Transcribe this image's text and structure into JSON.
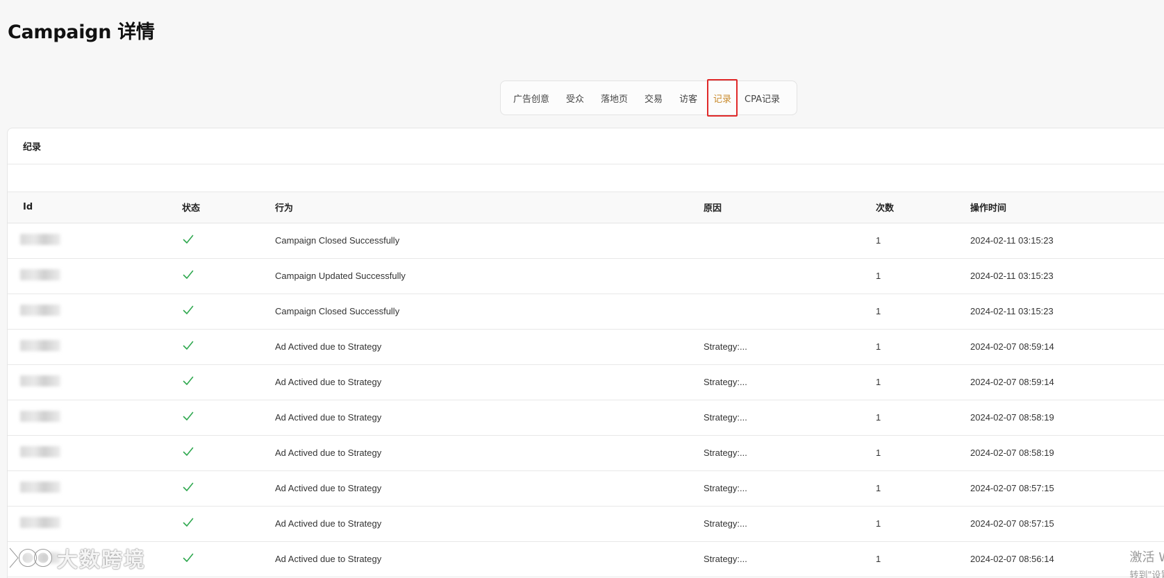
{
  "page": {
    "title": "Campaign 详情"
  },
  "tabs": [
    {
      "label": "广告创意",
      "active": false
    },
    {
      "label": "受众",
      "active": false
    },
    {
      "label": "落地页",
      "active": false
    },
    {
      "label": "交易",
      "active": false
    },
    {
      "label": "访客",
      "active": false
    },
    {
      "label": "记录",
      "active": true
    },
    {
      "label": "CPA记录",
      "active": false
    }
  ],
  "card": {
    "title": "纪录",
    "columns": [
      "Id",
      "状态",
      "行为",
      "原因",
      "次数",
      "操作时间"
    ],
    "rows": [
      {
        "status": "success",
        "action": "Campaign Closed Successfully",
        "reason": "",
        "count": "1",
        "time": "2024-02-11 03:15:23"
      },
      {
        "status": "success",
        "action": "Campaign Updated Successfully",
        "reason": "",
        "count": "1",
        "time": "2024-02-11 03:15:23"
      },
      {
        "status": "success",
        "action": "Campaign Closed Successfully",
        "reason": "",
        "count": "1",
        "time": "2024-02-11 03:15:23"
      },
      {
        "status": "success",
        "action": "Ad Actived due to Strategy",
        "reason": "Strategy:...",
        "count": "1",
        "time": "2024-02-07 08:59:14"
      },
      {
        "status": "success",
        "action": "Ad Actived due to Strategy",
        "reason": "Strategy:...",
        "count": "1",
        "time": "2024-02-07 08:59:14"
      },
      {
        "status": "success",
        "action": "Ad Actived due to Strategy",
        "reason": "Strategy:...",
        "count": "1",
        "time": "2024-02-07 08:58:19"
      },
      {
        "status": "success",
        "action": "Ad Actived due to Strategy",
        "reason": "Strategy:...",
        "count": "1",
        "time": "2024-02-07 08:58:19"
      },
      {
        "status": "success",
        "action": "Ad Actived due to Strategy",
        "reason": "Strategy:...",
        "count": "1",
        "time": "2024-02-07 08:57:15"
      },
      {
        "status": "success",
        "action": "Ad Actived due to Strategy",
        "reason": "Strategy:...",
        "count": "1",
        "time": "2024-02-07 08:57:15"
      },
      {
        "status": "success",
        "action": "Ad Actived due to Strategy",
        "reason": "Strategy:...",
        "count": "1",
        "time": "2024-02-07 08:56:14"
      }
    ]
  },
  "watermark": {
    "brand_text": "大数跨境",
    "activate_line1": "激活 W",
    "activate_line2": "转到\"设置"
  },
  "colors": {
    "active_tab": "#c98a2b",
    "highlight_border": "#e02828",
    "check": "#2fa84f"
  },
  "icons": {
    "status_success": "check-icon"
  }
}
